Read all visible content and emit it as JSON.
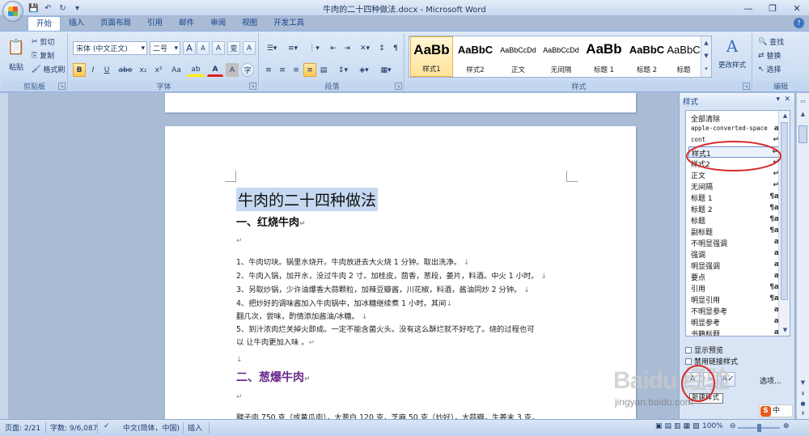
{
  "window": {
    "title": "牛肉的二十四种做法.docx - Microsoft Word",
    "controls": [
      "—",
      "❐",
      "✕"
    ]
  },
  "qat": {
    "save": "💾",
    "undo": "↶",
    "redo": "↻",
    "more": "▾"
  },
  "tabs": [
    "开始",
    "插入",
    "页面布局",
    "引用",
    "邮件",
    "审阅",
    "视图",
    "开发工具"
  ],
  "ribbon": {
    "clipboard": {
      "paste": "粘贴",
      "cut": "剪切",
      "copy": "复制",
      "format_painter": "格式刷",
      "label": "剪贴板"
    },
    "font": {
      "font_name": "宋体 (中文正文)",
      "font_size": "二号",
      "grow": "A",
      "shrink": "A",
      "clear": "A",
      "phonetic": "变",
      "border": "A",
      "bold": "B",
      "italic": "I",
      "underline": "U",
      "strike": "abe",
      "subscript": "x₂",
      "superscript": "x²",
      "case": "Aa",
      "highlight": "ab",
      "color": "A",
      "shade": "A",
      "circle": "字",
      "label": "字体"
    },
    "paragraph": {
      "label": "段落"
    },
    "styles": {
      "label": "样式",
      "gallery": [
        {
          "preview": "AaBb",
          "name": "样式1",
          "size": 17
        },
        {
          "preview": "AaBbC",
          "name": "样式2",
          "size": 13
        },
        {
          "preview": "AaBbCcDd",
          "name": "正文",
          "size": 9
        },
        {
          "preview": "AaBbCcDd",
          "name": "无间隔",
          "size": 9
        },
        {
          "preview": "AaBb",
          "name": "标题 1",
          "size": 17
        },
        {
          "preview": "AaBbC",
          "name": "标题 2",
          "size": 13
        },
        {
          "preview": "AaBbC",
          "name": "标题",
          "size": 13
        }
      ],
      "change_styles": "更改样式"
    },
    "editing": {
      "find": "查找",
      "replace": "替换",
      "select": "选择",
      "label": "编辑"
    }
  },
  "document": {
    "title": "牛肉的二十四种做法",
    "heading1": "一、红烧牛肉",
    "lines": [
      "1、牛肉切块。锅里水烧开。牛肉放进去大火烧 1 分钟。取出洗净。",
      "2、牛肉入锅，加开水，没过牛肉 2 寸。加桂皮，茴香，葱段，姜片，料酒。中火 1 小时。",
      "3、另取炒锅，少许油爆香大蒜颗粒，加辣豆瓣酱，川花椒，料酒，酱油同炒 2 分钟。",
      "4、把炒好的调味酱加入牛肉锅中，加冰糖继续煮 1 小时。其间",
      "翻几次，尝味，酌情添加酱油/冰糖。",
      "5、到汁浓肉烂关掉火即成。一定不能含菌火头。没有这么酥烂就不好吃了。烧的过程也可",
      "以 让牛肉更加入味 。"
    ],
    "heading2": "二、葱爆牛肉",
    "last_line": "腱子肉 750 克（或黄瓜肉），大葱白 120 克，芝麻 50 克（炒好），大蒜瓣，生姜末 3 克，"
  },
  "styles_pane": {
    "title": "样式",
    "items": [
      {
        "name": "全部清除",
        "icon": ""
      },
      {
        "name": "apple-converted-space",
        "icon": "a"
      },
      {
        "name": "cont",
        "icon": "↵"
      },
      {
        "name": "样式1",
        "icon": "↵"
      },
      {
        "name": "样式2",
        "icon": "↵"
      },
      {
        "name": "正文",
        "icon": "↵"
      },
      {
        "name": "无间隔",
        "icon": "↵"
      },
      {
        "name": "标题 1",
        "icon": "¶a"
      },
      {
        "name": "标题 2",
        "icon": "¶a"
      },
      {
        "name": "标题",
        "icon": "¶a"
      },
      {
        "name": "副标题",
        "icon": "¶a"
      },
      {
        "name": "不明显强调",
        "icon": "a"
      },
      {
        "name": "强调",
        "icon": "a"
      },
      {
        "name": "明显强调",
        "icon": "a"
      },
      {
        "name": "要点",
        "icon": "a"
      },
      {
        "name": "引用",
        "icon": "¶a"
      },
      {
        "name": "明显引用",
        "icon": "¶a"
      },
      {
        "name": "不明显参考",
        "icon": "a"
      },
      {
        "name": "明显参考",
        "icon": "a"
      },
      {
        "name": "书籍标题",
        "icon": "a"
      }
    ],
    "show_preview": "显示预览",
    "disable_linked": "禁用链接样式",
    "options": "选项...",
    "tooltip": "新建样式"
  },
  "status": {
    "page": "页面: 2/21",
    "words": "字数: 9/6,087",
    "language": "中文(简体，中国)",
    "insert": "插入",
    "zoom": "100%"
  },
  "watermark": {
    "text": "Baidu 经验",
    "url": "jingyan.baidu.com"
  },
  "ime": {
    "label": "中"
  },
  "colors": {
    "accent": "#15428b",
    "highlight": "#c6d9f1",
    "annotation": "#d62b2b",
    "heading2": "#6b2a8c"
  }
}
